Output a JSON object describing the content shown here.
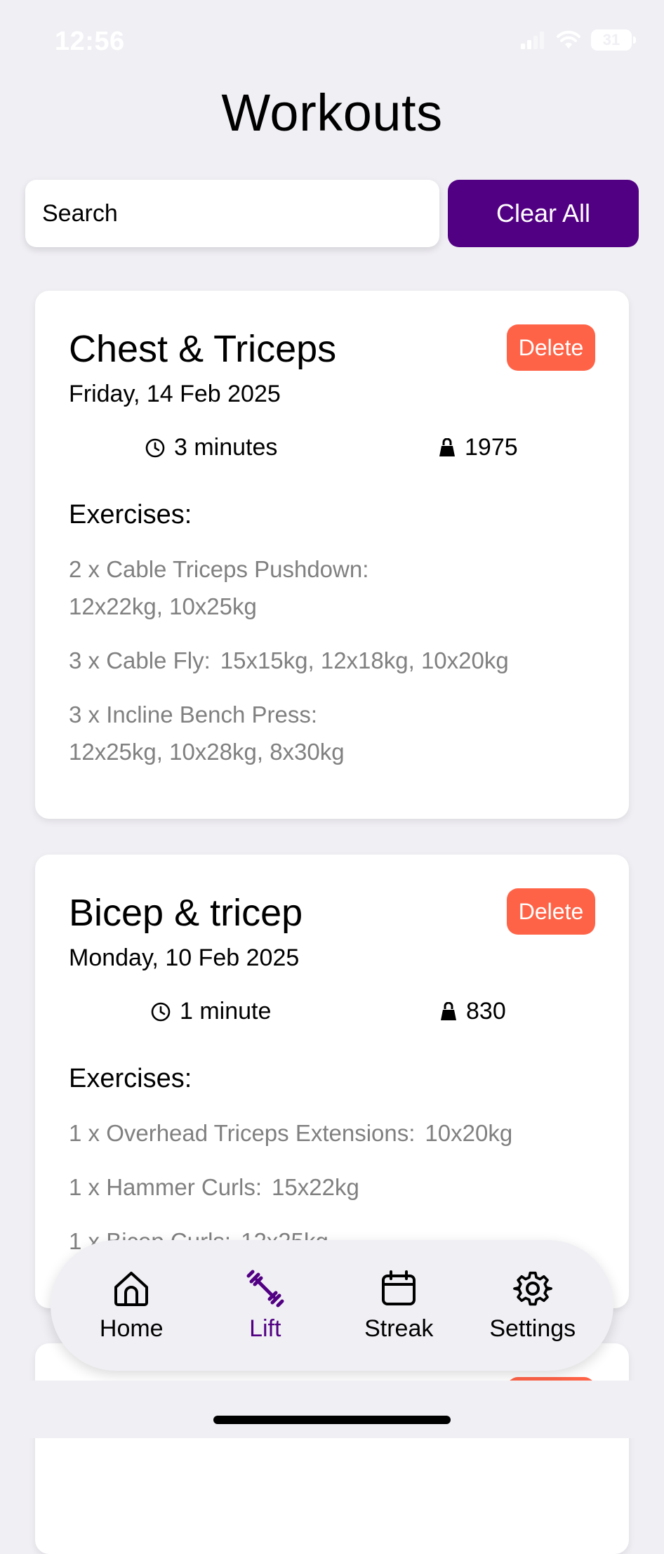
{
  "status_bar": {
    "time": "12:56",
    "battery": "31"
  },
  "page": {
    "title": "Workouts"
  },
  "search": {
    "placeholder": "Search",
    "value": ""
  },
  "actions": {
    "clear_all_label": "Clear All"
  },
  "workouts": [
    {
      "title": "Chest & Triceps",
      "date": "Friday, 14 Feb 2025",
      "duration": "3 minutes",
      "weight": "1975",
      "delete_label": "Delete",
      "exercises_heading": "Exercises:",
      "exercises": [
        {
          "name": "2 x Cable Triceps Pushdown:",
          "sets": "12x22kg, 10x25kg"
        },
        {
          "name": "3 x Cable Fly:",
          "sets": "15x15kg, 12x18kg, 10x20kg"
        },
        {
          "name": "3 x Incline Bench Press:",
          "sets": "12x25kg, 10x28kg, 8x30kg"
        }
      ]
    },
    {
      "title": "Bicep & tricep",
      "date": "Monday, 10 Feb 2025",
      "duration": "1 minute",
      "weight": "830",
      "delete_label": "Delete",
      "exercises_heading": "Exercises:",
      "exercises": [
        {
          "name": "1 x Overhead Triceps Extensions:",
          "sets": "10x20kg"
        },
        {
          "name": "1 x Hammer Curls:",
          "sets": "15x22kg"
        },
        {
          "name": "1 x Bicep Curls:",
          "sets": "12x25kg"
        }
      ]
    }
  ],
  "tab_bar": {
    "items": [
      {
        "label": "Home",
        "icon": "home-icon",
        "active": false
      },
      {
        "label": "Lift",
        "icon": "dumbbell-icon",
        "active": true
      },
      {
        "label": "Streak",
        "icon": "calendar-icon",
        "active": false
      },
      {
        "label": "Settings",
        "icon": "gear-icon",
        "active": false
      }
    ]
  },
  "colors": {
    "background": "#f0eff4",
    "accent": "#520083",
    "delete": "#ff6347",
    "muted_text": "#808080"
  }
}
